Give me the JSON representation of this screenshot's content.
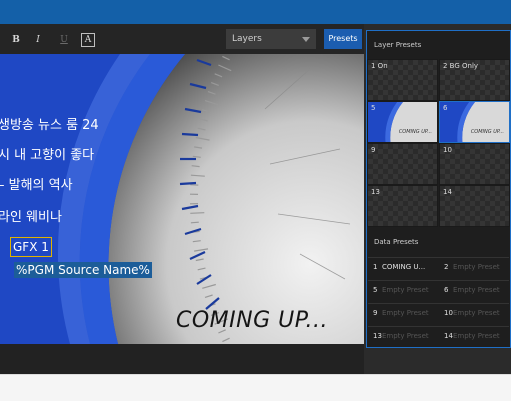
{
  "toolbar": {
    "bold_label": "B",
    "italic_label": "I",
    "underline_label": "U",
    "box_label": "A",
    "layers_select": "Layers",
    "presets_button": "Presets"
  },
  "canvas": {
    "korean_lines": [
      "생방송 뉴스 룸 24",
      "시 내 고향이 좋다",
      "– 발해의 역사",
      "라인 웨비나"
    ],
    "gfx_label": "GFX 1",
    "pgm_source": "%PGM Source Name%",
    "coming_up": "COMING UP..."
  },
  "layer_presets": {
    "title": "Layer Presets",
    "cells": [
      {
        "label": "1 On"
      },
      {
        "label": "2 BG Only"
      },
      {
        "label": "5"
      },
      {
        "label": "6"
      },
      {
        "label": "9"
      },
      {
        "label": "10"
      },
      {
        "label": "13"
      },
      {
        "label": "14"
      }
    ],
    "thumb_text": "COMING UP..."
  },
  "data_presets": {
    "title": "Data Presets",
    "rows": [
      [
        {
          "num": "1",
          "name": "COMING U..."
        },
        {
          "num": "2",
          "name": "Empty Preset"
        }
      ],
      [
        {
          "num": "5",
          "name": "Empty Preset"
        },
        {
          "num": "6",
          "name": "Empty Preset"
        }
      ],
      [
        {
          "num": "9",
          "name": "Empty Preset"
        },
        {
          "num": "10",
          "name": "Empty Preset"
        }
      ],
      [
        {
          "num": "13",
          "name": "Empty Preset"
        },
        {
          "num": "14",
          "name": "Empty Preset"
        }
      ]
    ]
  },
  "colors": {
    "accent": "#1b5db0",
    "topbar": "#1460a8",
    "canvas_blue": "#1f48c4",
    "gfx_border": "#e0b400"
  }
}
